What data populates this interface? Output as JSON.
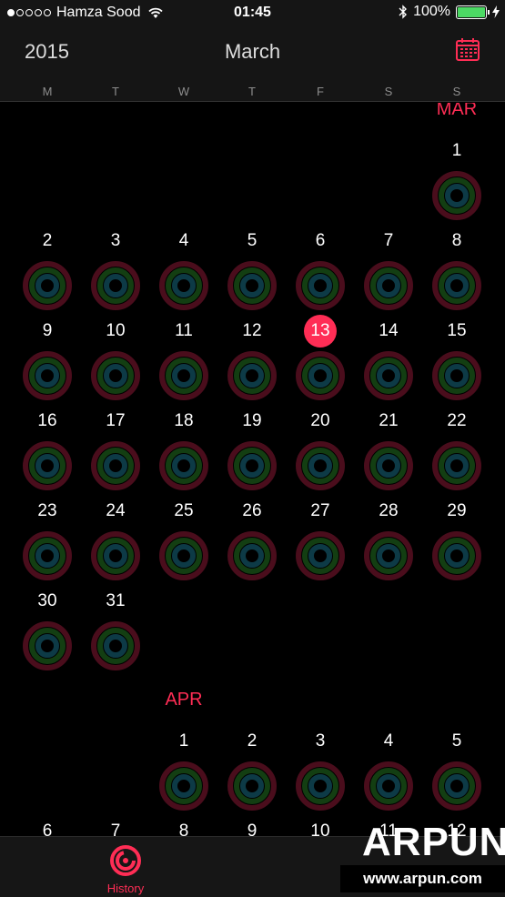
{
  "status_bar": {
    "carrier": "Hamza Sood",
    "time": "01:45",
    "battery": "100%",
    "signal_dots_filled": 1,
    "signal_dots_total": 5
  },
  "nav": {
    "year": "2015",
    "month": "March",
    "calendar_icon": "calendar-icon"
  },
  "weekdays": [
    "M",
    "T",
    "W",
    "T",
    "F",
    "S",
    "S"
  ],
  "today": "13",
  "march": {
    "label": "MAR",
    "rows": [
      [
        "",
        "",
        "",
        "",
        "",
        "",
        "1"
      ],
      [
        "2",
        "3",
        "4",
        "5",
        "6",
        "7",
        "8"
      ],
      [
        "9",
        "10",
        "11",
        "12",
        "13",
        "14",
        "15"
      ],
      [
        "16",
        "17",
        "18",
        "19",
        "20",
        "21",
        "22"
      ],
      [
        "23",
        "24",
        "25",
        "26",
        "27",
        "28",
        "29"
      ],
      [
        "30",
        "31",
        "",
        "",
        "",
        "",
        ""
      ]
    ]
  },
  "april": {
    "label": "APR",
    "rows": [
      [
        "",
        "",
        "1",
        "2",
        "3",
        "4",
        "5"
      ],
      [
        "6",
        "7",
        "8",
        "9",
        "10",
        "11",
        "12"
      ]
    ]
  },
  "tab_bar": {
    "history_label": "History",
    "history_icon": "activity-rings-icon"
  },
  "watermark": {
    "logo": "ARPUN",
    "url": "www.arpun.com"
  },
  "colors": {
    "accent": "#ff2d55",
    "ring_move": "#4a0d1c",
    "ring_exercise": "#133e12",
    "ring_stand": "#0d3a46",
    "battery": "#4cd964"
  }
}
